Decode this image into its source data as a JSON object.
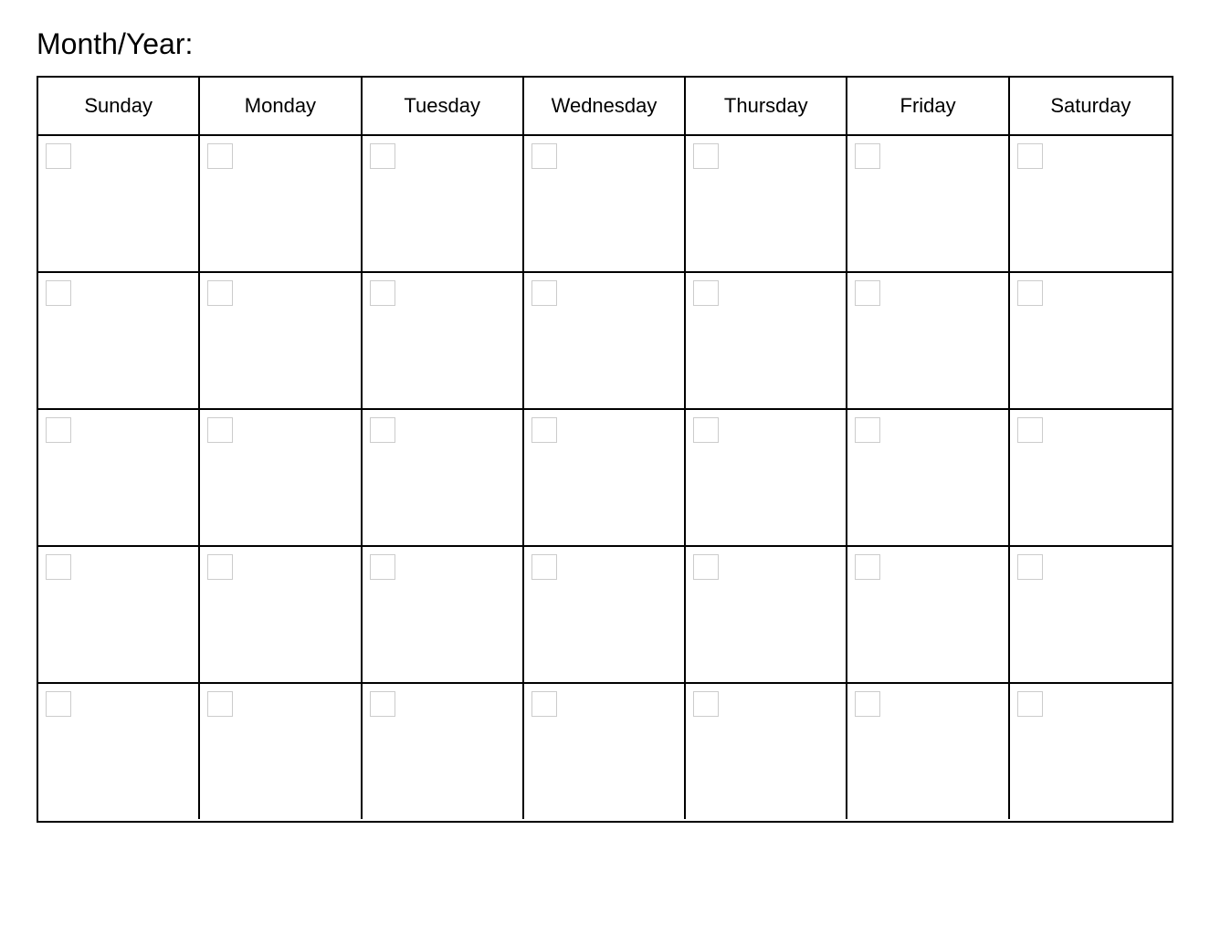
{
  "header": {
    "month_year_label": "Month/Year:"
  },
  "calendar": {
    "days": [
      "Sunday",
      "Monday",
      "Tuesday",
      "Wednesday",
      "Thursday",
      "Friday",
      "Saturday"
    ],
    "rows": 5
  }
}
